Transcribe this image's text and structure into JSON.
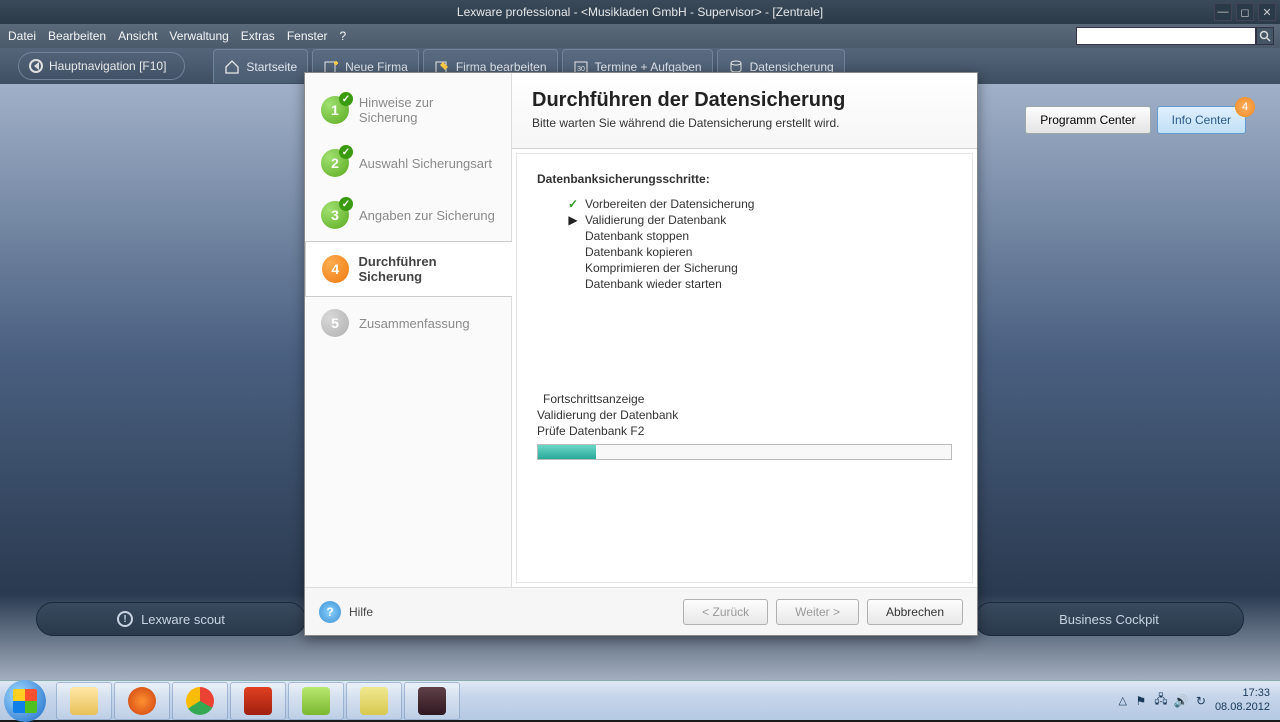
{
  "titlebar": {
    "text": "Lexware professional - <Musikladen GmbH - Supervisor> - [Zentrale]"
  },
  "menu": {
    "items": [
      "Datei",
      "Bearbeiten",
      "Ansicht",
      "Verwaltung",
      "Extras",
      "Fenster",
      "?"
    ]
  },
  "search": {
    "placeholder": ""
  },
  "nav_pill": {
    "label": "Hauptnavigation [F10]"
  },
  "toolbar": {
    "items": [
      {
        "label": "Startseite"
      },
      {
        "label": "Neue Firma"
      },
      {
        "label": "Firma bearbeiten"
      },
      {
        "label": "Termine + Aufgaben"
      },
      {
        "label": "Datensicherung"
      }
    ]
  },
  "right_buttons": {
    "programm": "Programm Center",
    "info": "Info Center",
    "badge": "4"
  },
  "bottom_bars": {
    "left": "Lexware scout",
    "right": "Business Cockpit"
  },
  "wizard": {
    "steps": [
      {
        "num": "1",
        "label": "Hinweise zur Sicherung",
        "state": "done"
      },
      {
        "num": "2",
        "label": "Auswahl Sicherungsart",
        "state": "done"
      },
      {
        "num": "3",
        "label": "Angaben zur Sicherung",
        "state": "done"
      },
      {
        "num": "4",
        "label": "Durchführen Sicherung",
        "state": "current"
      },
      {
        "num": "5",
        "label": "Zusammenfassung",
        "state": "pending"
      }
    ],
    "title": "Durchführen der Datensicherung",
    "subtitle": "Bitte warten Sie während die Datensicherung erstellt wird.",
    "steps_heading": "Datenbanksicherungsschritte:",
    "db_steps": [
      {
        "mark": "check",
        "label": "Vorbereiten der Datensicherung"
      },
      {
        "mark": "arrow",
        "label": "Validierung der Datenbank"
      },
      {
        "mark": "",
        "label": "Datenbank stoppen"
      },
      {
        "mark": "",
        "label": "Datenbank kopieren"
      },
      {
        "mark": "",
        "label": "Komprimieren der Sicherung"
      },
      {
        "mark": "",
        "label": "Datenbank wieder starten"
      }
    ],
    "progress": {
      "label": "Fortschrittsanzeige",
      "line1": "Validierung der Datenbank",
      "line2": "Prüfe Datenbank F2"
    },
    "footer": {
      "help": "Hilfe",
      "back": "< Zurück",
      "next": "Weiter >",
      "cancel": "Abbrechen"
    }
  },
  "taskbar": {
    "time": "17:33",
    "date": "08.08.2012"
  }
}
